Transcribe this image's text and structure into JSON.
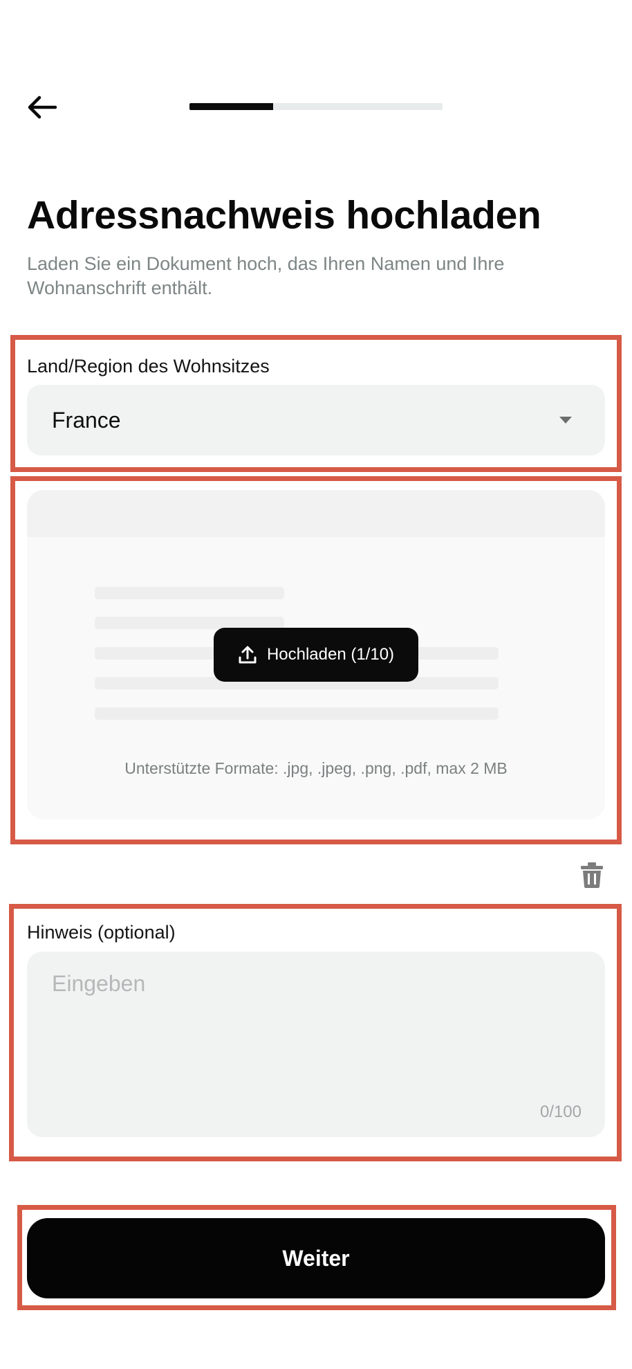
{
  "header": {
    "back_icon": "arrow-left-icon",
    "progress": 0.33
  },
  "page": {
    "title": "Adressnachweis hochladen",
    "subtitle": "Laden Sie ein Dokument hoch, das Ihren Namen und Ihre Wohnanschrift enthält."
  },
  "country_section": {
    "label": "Land/Region des Wohnsitzes",
    "selected_value": "France",
    "icon": "caret-down-icon"
  },
  "upload_section": {
    "button_label": "Hochladen (1/10)",
    "button_icon": "upload-icon",
    "formats_hint": "Unterstützte Formate: .jpg, .jpeg, .png, .pdf, max 2 MB",
    "delete_icon": "trash-icon"
  },
  "note_section": {
    "label": "Hinweis (optional)",
    "placeholder": "Eingeben",
    "value": "",
    "char_count": "0/100"
  },
  "footer": {
    "continue_label": "Weiter"
  },
  "colors": {
    "highlight_border": "#d65a46",
    "primary_button": "#050505",
    "input_background": "#f1f3f3"
  }
}
